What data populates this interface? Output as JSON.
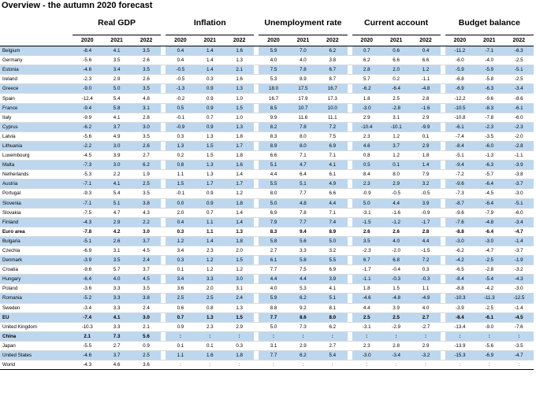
{
  "title": "Overview - the autumn 2020 forecast",
  "groups": [
    "Real GDP",
    "Inflation",
    "Unemployment rate",
    "Current account",
    "Budget balance"
  ],
  "years": [
    "2020",
    "2021",
    "2022"
  ],
  "highlight_color": "#bdd7ee",
  "rows": [
    {
      "name": "Belgium",
      "hl": true,
      "v": [
        [
          "-8.4",
          "4.1",
          "3.5"
        ],
        [
          "0.4",
          "1.4",
          "1.6"
        ],
        [
          "5.9",
          "7.0",
          "6.2"
        ],
        [
          "0.7",
          "0.6",
          "0.4"
        ],
        [
          "-11.2",
          "-7.1",
          "-6.3"
        ]
      ]
    },
    {
      "name": "Germany",
      "hl": false,
      "v": [
        [
          "-5.6",
          "3.5",
          "2.6"
        ],
        [
          "0.4",
          "1.4",
          "1.3"
        ],
        [
          "4.0",
          "4.0",
          "3.8"
        ],
        [
          "6.2",
          "6.6",
          "6.6"
        ],
        [
          "-6.0",
          "-4.0",
          "-2.5"
        ]
      ]
    },
    {
      "name": "Estonia",
      "hl": true,
      "v": [
        [
          "-4.6",
          "3.4",
          "3.5"
        ],
        [
          "-0.5",
          "1.4",
          "2.1"
        ],
        [
          "7.5",
          "7.8",
          "6.7"
        ],
        [
          "2.8",
          "2.0",
          "1.2"
        ],
        [
          "-5.9",
          "-5.9",
          "-5.1"
        ]
      ]
    },
    {
      "name": "Ireland",
      "hl": false,
      "v": [
        [
          "-2.3",
          "2.9",
          "2.6"
        ],
        [
          "-0.5",
          "0.3",
          "1.6"
        ],
        [
          "5.3",
          "8.9",
          "8.7"
        ],
        [
          "5.7",
          "0.2",
          "-1.1"
        ],
        [
          "-6.8",
          "-5.8",
          "-2.5"
        ]
      ]
    },
    {
      "name": "Greece",
      "hl": true,
      "v": [
        [
          "-9.0",
          "5.0",
          "3.5"
        ],
        [
          "-1.3",
          "0.9",
          "1.3"
        ],
        [
          "18.0",
          "17.5",
          "16.7"
        ],
        [
          "-6.2",
          "-6.4",
          "-4.8"
        ],
        [
          "-6.9",
          "-6.3",
          "-3.4"
        ]
      ]
    },
    {
      "name": "Spain",
      "hl": false,
      "v": [
        [
          "-12.4",
          "5.4",
          "4.8"
        ],
        [
          "-0.2",
          "0.9",
          "1.0"
        ],
        [
          "16.7",
          "17.9",
          "17.3"
        ],
        [
          "1.8",
          "2.5",
          "2.8"
        ],
        [
          "-12.2",
          "-9.6",
          "-8.6"
        ]
      ]
    },
    {
      "name": "France",
      "hl": true,
      "v": [
        [
          "-9.4",
          "5.8",
          "3.1"
        ],
        [
          "0.5",
          "0.9",
          "1.5"
        ],
        [
          "8.5",
          "10.7",
          "10.0"
        ],
        [
          "-3.0",
          "-2.8",
          "-1.6"
        ],
        [
          "-10.5",
          "-8.3",
          "-6.1"
        ]
      ]
    },
    {
      "name": "Italy",
      "hl": false,
      "v": [
        [
          "-9.9",
          "4.1",
          "2.8"
        ],
        [
          "-0.1",
          "0.7",
          "1.0"
        ],
        [
          "9.9",
          "11.6",
          "11.1"
        ],
        [
          "2.9",
          "3.1",
          "2.9"
        ],
        [
          "-10.8",
          "-7.8",
          "-6.0"
        ]
      ]
    },
    {
      "name": "Cyprus",
      "hl": true,
      "v": [
        [
          "-6.2",
          "3.7",
          "3.0"
        ],
        [
          "-0.9",
          "0.9",
          "1.3"
        ],
        [
          "8.2",
          "7.8",
          "7.2"
        ],
        [
          "-10.4",
          "-10.1",
          "-9.9"
        ],
        [
          "-6.1",
          "-2.3",
          "-2.3"
        ]
      ]
    },
    {
      "name": "Latvia",
      "hl": false,
      "v": [
        [
          "-5.6",
          "4.9",
          "3.5"
        ],
        [
          "0.3",
          "1.3",
          "1.8"
        ],
        [
          "8.3",
          "8.0",
          "7.5"
        ],
        [
          "2.3",
          "1.2",
          "0.1"
        ],
        [
          "-7.4",
          "-3.5",
          "-2.0"
        ]
      ]
    },
    {
      "name": "Lithuania",
      "hl": true,
      "v": [
        [
          "-2.2",
          "3.0",
          "2.6"
        ],
        [
          "1.3",
          "1.5",
          "1.7"
        ],
        [
          "8.9",
          "8.0",
          "6.9"
        ],
        [
          "4.6",
          "3.7",
          "2.9"
        ],
        [
          "-8.4",
          "-6.0",
          "-2.8"
        ]
      ]
    },
    {
      "name": "Luxembourg",
      "hl": false,
      "v": [
        [
          "-4.5",
          "3.9",
          "2.7"
        ],
        [
          "0.2",
          "1.5",
          "1.8"
        ],
        [
          "6.6",
          "7.1",
          "7.1"
        ],
        [
          "0.8",
          "1.2",
          "1.8"
        ],
        [
          "-5.1",
          "-1.3",
          "-1.1"
        ]
      ]
    },
    {
      "name": "Malta",
      "hl": true,
      "v": [
        [
          "-7.3",
          "3.0",
          "6.2"
        ],
        [
          "0.8",
          "1.3",
          "1.6"
        ],
        [
          "5.1",
          "4.7",
          "4.1"
        ],
        [
          "0.5",
          "0.1",
          "1.4"
        ],
        [
          "-9.4",
          "-6.3",
          "-3.9"
        ]
      ]
    },
    {
      "name": "Netherlands",
      "hl": false,
      "v": [
        [
          "-5.3",
          "2.2",
          "1.9"
        ],
        [
          "1.1",
          "1.3",
          "1.4"
        ],
        [
          "4.4",
          "6.4",
          "6.1"
        ],
        [
          "8.4",
          "8.0",
          "7.9"
        ],
        [
          "-7.2",
          "-5.7",
          "-3.8"
        ]
      ]
    },
    {
      "name": "Austria",
      "hl": true,
      "v": [
        [
          "-7.1",
          "4.1",
          "2.5"
        ],
        [
          "1.5",
          "1.7",
          "1.7"
        ],
        [
          "5.5",
          "5.1",
          "4.9"
        ],
        [
          "2.3",
          "2.9",
          "3.2"
        ],
        [
          "-9.6",
          "-6.4",
          "-3.7"
        ]
      ]
    },
    {
      "name": "Portugal",
      "hl": false,
      "v": [
        [
          "-9.3",
          "5.4",
          "3.5"
        ],
        [
          "-0.1",
          "0.9",
          "1.2"
        ],
        [
          "8.0",
          "7.7",
          "6.6"
        ],
        [
          "-0.9",
          "-0.5",
          "-0.5"
        ],
        [
          "-7.3",
          "-4.5",
          "-3.0"
        ]
      ]
    },
    {
      "name": "Slovenia",
      "hl": true,
      "v": [
        [
          "-7.1",
          "5.1",
          "3.8"
        ],
        [
          "0.0",
          "0.9",
          "1.8"
        ],
        [
          "5.0",
          "4.8",
          "4.4"
        ],
        [
          "5.0",
          "4.4",
          "3.9"
        ],
        [
          "-8.7",
          "-6.4",
          "-5.1"
        ]
      ]
    },
    {
      "name": "Slovakia",
      "hl": false,
      "v": [
        [
          "-7.5",
          "4.7",
          "4.3"
        ],
        [
          "2.0",
          "0.7",
          "1.4"
        ],
        [
          "6.9",
          "7.8",
          "7.1"
        ],
        [
          "-3.1",
          "-1.6",
          "-0.9"
        ],
        [
          "-9.6",
          "-7.9",
          "-6.0"
        ]
      ]
    },
    {
      "name": "Finland",
      "hl": true,
      "v": [
        [
          "-4.3",
          "2.9",
          "2.2"
        ],
        [
          "0.4",
          "1.1",
          "1.4"
        ],
        [
          "7.9",
          "7.7",
          "7.4"
        ],
        [
          "-1.5",
          "-1.2",
          "-1.7"
        ],
        [
          "-7.6",
          "-4.8",
          "-3.4"
        ]
      ]
    },
    {
      "name": "Euro area",
      "hl": false,
      "bold": true,
      "sep": true,
      "v": [
        [
          "-7.8",
          "4.2",
          "3.0"
        ],
        [
          "0.3",
          "1.1",
          "1.3"
        ],
        [
          "8.3",
          "9.4",
          "8.9"
        ],
        [
          "2.6",
          "2.6",
          "2.8"
        ],
        [
          "-8.8",
          "-6.4",
          "-4.7"
        ]
      ]
    },
    {
      "name": "Bulgaria",
      "hl": true,
      "sep": true,
      "v": [
        [
          "-5.1",
          "2.6",
          "3.7"
        ],
        [
          "1.2",
          "1.4",
          "1.8"
        ],
        [
          "5.8",
          "5.6",
          "5.0"
        ],
        [
          "3.5",
          "4.0",
          "4.4"
        ],
        [
          "-3.0",
          "-3.0",
          "-1.4"
        ]
      ]
    },
    {
      "name": "Czechia",
      "hl": false,
      "v": [
        [
          "-6.9",
          "3.1",
          "4.5"
        ],
        [
          "3.4",
          "2.3",
          "2.0"
        ],
        [
          "2.7",
          "3.3",
          "3.2"
        ],
        [
          "-2.3",
          "-2.0",
          "-1.5"
        ],
        [
          "-6.2",
          "-4.7",
          "-3.7"
        ]
      ]
    },
    {
      "name": "Denmark",
      "hl": true,
      "v": [
        [
          "-3.9",
          "3.5",
          "2.4"
        ],
        [
          "0.3",
          "1.2",
          "1.5"
        ],
        [
          "6.1",
          "5.8",
          "5.5"
        ],
        [
          "6.7",
          "6.8",
          "7.2"
        ],
        [
          "-4.2",
          "-2.5",
          "-1.9"
        ]
      ]
    },
    {
      "name": "Croatia",
      "hl": false,
      "v": [
        [
          "-9.6",
          "5.7",
          "3.7"
        ],
        [
          "0.1",
          "1.2",
          "1.2"
        ],
        [
          "7.7",
          "7.5",
          "6.9"
        ],
        [
          "-1.7",
          "-0.4",
          "0.3"
        ],
        [
          "-6.5",
          "-2.8",
          "-3.2"
        ]
      ]
    },
    {
      "name": "Hungary",
      "hl": true,
      "v": [
        [
          "-6.4",
          "4.0",
          "4.5"
        ],
        [
          "3.4",
          "3.3",
          "3.0"
        ],
        [
          "4.4",
          "4.4",
          "3.9"
        ],
        [
          "-1.1",
          "-0.3",
          "-0.3"
        ],
        [
          "-8.4",
          "-5.4",
          "-4.3"
        ]
      ]
    },
    {
      "name": "Poland",
      "hl": false,
      "v": [
        [
          "-3.6",
          "3.3",
          "3.5"
        ],
        [
          "3.6",
          "2.0",
          "3.1"
        ],
        [
          "4.0",
          "5.3",
          "4.1"
        ],
        [
          "1.8",
          "1.5",
          "1.1"
        ],
        [
          "-8.8",
          "-4.2",
          "-3.0"
        ]
      ]
    },
    {
      "name": "Romania",
      "hl": true,
      "v": [
        [
          "-5.2",
          "3.3",
          "3.8"
        ],
        [
          "2.5",
          "2.5",
          "2.4"
        ],
        [
          "5.9",
          "6.2",
          "5.1"
        ],
        [
          "-4.6",
          "-4.8",
          "-4.9"
        ],
        [
          "-10.3",
          "-11.3",
          "-12.5"
        ]
      ]
    },
    {
      "name": "Sweden",
      "hl": false,
      "v": [
        [
          "-3.4",
          "3.3",
          "2.4"
        ],
        [
          "0.6",
          "0.8",
          "1.3"
        ],
        [
          "8.8",
          "9.2",
          "8.1"
        ],
        [
          "4.4",
          "3.9",
          "4.0"
        ],
        [
          "-3.9",
          "-2.5",
          "-1.4"
        ]
      ]
    },
    {
      "name": "EU",
      "hl": true,
      "bold": true,
      "sep": true,
      "v": [
        [
          "-7.4",
          "4.1",
          "3.0"
        ],
        [
          "0.7",
          "1.3",
          "1.5"
        ],
        [
          "7.7",
          "8.6",
          "8.0"
        ],
        [
          "2.5",
          "2.5",
          "2.7"
        ],
        [
          "-8.4",
          "-6.1",
          "-4.5"
        ]
      ]
    },
    {
      "name": "United Kingdom",
      "hl": false,
      "sep": true,
      "v": [
        [
          "-10.3",
          "3.3",
          "2.1"
        ],
        [
          "0.9",
          "2.3",
          "2.9"
        ],
        [
          "5.0",
          "7.3",
          "6.2"
        ],
        [
          "-3.1",
          "-2.9",
          "-2.7"
        ],
        [
          "-13.4",
          "-9.0",
          "-7.6"
        ]
      ]
    },
    {
      "name": "China",
      "hl": true,
      "bold": true,
      "v": [
        [
          "2.1",
          "7.3",
          "5.6"
        ],
        [
          ":",
          ":",
          ":"
        ],
        [
          ":",
          ":",
          ":"
        ],
        [
          ":",
          ":",
          ":"
        ],
        [
          ":",
          ":",
          ":"
        ]
      ]
    },
    {
      "name": "Japan",
      "hl": false,
      "v": [
        [
          "-5.5",
          "2.7",
          "0.9"
        ],
        [
          "0.1",
          "0.1",
          "0.3"
        ],
        [
          "3.1",
          "2.9",
          "2.7"
        ],
        [
          "2.3",
          "2.8",
          "2.9"
        ],
        [
          "-13.9",
          "-5.6",
          "-3.5"
        ]
      ]
    },
    {
      "name": "United States",
      "hl": true,
      "v": [
        [
          "-4.6",
          "3.7",
          "2.5"
        ],
        [
          "1.1",
          "1.6",
          "1.8"
        ],
        [
          "7.7",
          "6.2",
          "5.4"
        ],
        [
          "-3.0",
          "-3.4",
          "-3.2"
        ],
        [
          "-15.3",
          "-6.9",
          "-4.7"
        ]
      ]
    },
    {
      "name": "World",
      "hl": false,
      "last": true,
      "v": [
        [
          "-4.3",
          "4.6",
          "3.6"
        ],
        [
          ":",
          ":",
          ":"
        ],
        [
          ":",
          ":",
          ":"
        ],
        [
          ":",
          ":",
          ":"
        ],
        [
          ":",
          ":",
          ":"
        ]
      ]
    }
  ]
}
